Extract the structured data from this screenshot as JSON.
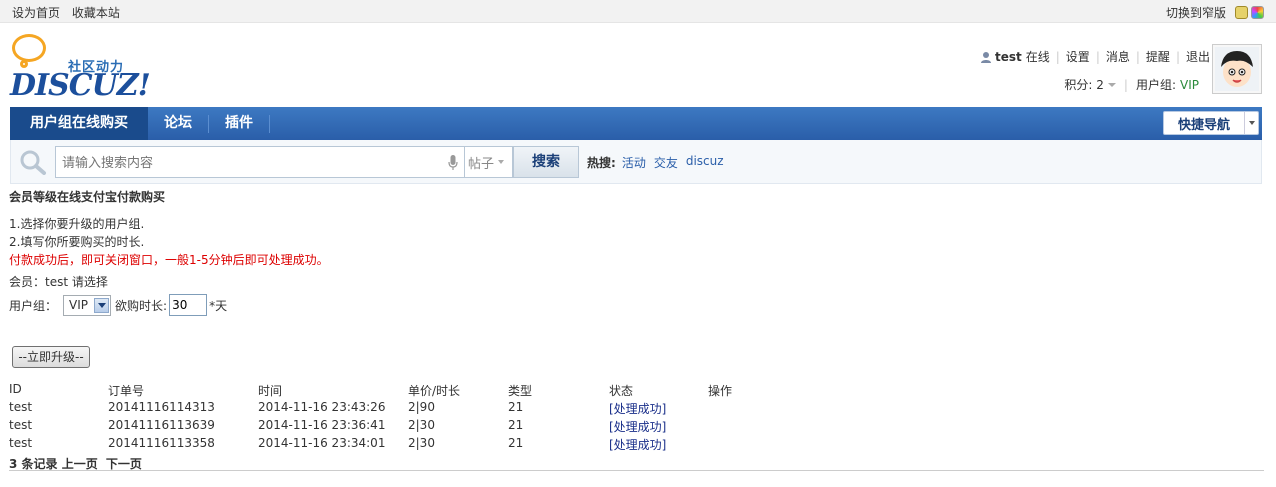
{
  "topbar": {
    "set_home": "设为首页",
    "bookmark": "收藏本站",
    "switch_width": "切换到窄版"
  },
  "logo": {
    "subtitle": "社区动力",
    "brand": "DISCUZ!"
  },
  "user": {
    "name": "test",
    "status": "在线",
    "links": [
      "设置",
      "消息",
      "提醒",
      "退出"
    ],
    "credit_label": "积分: 2",
    "group_label": "用户组:",
    "group_value": "VIP"
  },
  "nav": {
    "items": [
      "用户组在线购买",
      "论坛",
      "插件"
    ],
    "quick_nav": "快捷导航"
  },
  "search": {
    "placeholder": "请输入搜索内容",
    "type": "帖子",
    "button": "搜索",
    "hot_label": "热搜:",
    "hot_terms": [
      "活动",
      "交友",
      "discuz"
    ]
  },
  "page": {
    "title": "会员等级在线支付宝付款购买",
    "step1": "1.选择你要升级的用户组.",
    "step2": "2.填写你所要购买的时长.",
    "warning": "付款成功后，即可关闭窗口，一般1-5分钟后即可处理成功。",
    "member_line": "会员：test 请选择",
    "group_label": "用户组：",
    "group_value": "VIP",
    "duration_label": "欲购时长:",
    "duration_value": "30",
    "duration_unit": "*天",
    "upgrade_button": "--立即升级--"
  },
  "orders": {
    "headers": [
      "ID",
      "订单号",
      "时间",
      "单价/时长",
      "类型",
      "状态",
      "操作"
    ],
    "rows": [
      [
        "test",
        "20141116114313",
        "2014-11-16 23:43:26",
        "2|90",
        "21",
        "[处理成功]"
      ],
      [
        "test",
        "20141116113639",
        "2014-11-16 23:36:41",
        "2|30",
        "21",
        "[处理成功]"
      ],
      [
        "test",
        "20141116113358",
        "2014-11-16 23:34:01",
        "2|30",
        "21",
        "[处理成功]"
      ]
    ],
    "count_text": "3 条记录",
    "prev": "上一页",
    "next": "下一页"
  }
}
